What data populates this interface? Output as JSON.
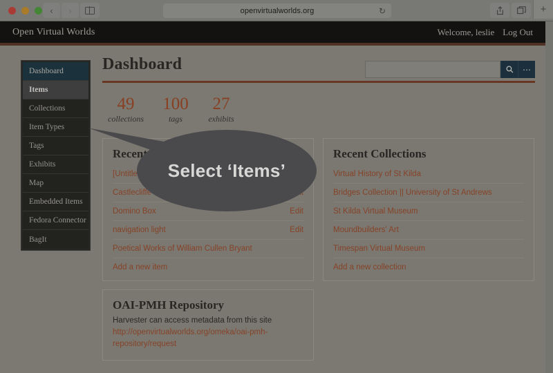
{
  "browser": {
    "url": "openvirtualworlds.org",
    "reload_icon": "reload-icon",
    "back_icon": "‹",
    "forward_icon": "›",
    "sidebar_icon": "sidebar-icon",
    "share_icon": "⇧",
    "tabs_icon": "tabs-icon",
    "newtab_icon": "+"
  },
  "site_header": {
    "title": "Open Virtual Worlds",
    "welcome": "Welcome, leslie",
    "logout": "Log Out"
  },
  "sidebar": {
    "items": [
      {
        "label": "Dashboard",
        "state": "active"
      },
      {
        "label": "Items",
        "state": "highlight"
      },
      {
        "label": "Collections",
        "state": "normal"
      },
      {
        "label": "Item Types",
        "state": "normal"
      },
      {
        "label": "Tags",
        "state": "normal"
      },
      {
        "label": "Exhibits",
        "state": "normal"
      },
      {
        "label": "Map",
        "state": "normal"
      },
      {
        "label": "Embedded Items",
        "state": "normal"
      },
      {
        "label": "Fedora Connector",
        "state": "normal"
      },
      {
        "label": "BagIt",
        "state": "normal"
      }
    ]
  },
  "main": {
    "page_title": "Dashboard",
    "search": {
      "value": "",
      "placeholder": "",
      "search_icon": "⌕",
      "options_icon": "⋯"
    },
    "stats": [
      {
        "number": "49",
        "label": "collections"
      },
      {
        "number": "100",
        "label": "tags"
      },
      {
        "number": "27",
        "label": "exhibits"
      }
    ],
    "recent_items": {
      "title": "Recent Items",
      "rows": [
        {
          "label": "[Untitled]",
          "edit": ""
        },
        {
          "label": "Castlecliffe",
          "edit": "Edit"
        },
        {
          "label": "Domino Box",
          "edit": "Edit"
        },
        {
          "label": "navigation light",
          "edit": "Edit"
        },
        {
          "label": "Poetical Works of William Cullen Bryant",
          "edit": ""
        },
        {
          "label": "Add a new item",
          "edit": ""
        }
      ]
    },
    "recent_collections": {
      "title": "Recent Collections",
      "rows": [
        {
          "label": "Virtual History of St Kilda",
          "edit": ""
        },
        {
          "label": "Bridges Collection || University of St Andrews",
          "edit": ""
        },
        {
          "label": "St Kilda Virtual Museum",
          "edit": ""
        },
        {
          "label": "Moundbuilders' Art",
          "edit": ""
        },
        {
          "label": "Timespan Virtual Museum",
          "edit": ""
        },
        {
          "label": "Add a new collection",
          "edit": ""
        }
      ]
    },
    "oai": {
      "title": "OAI-PMH Repository",
      "description": "Harvester can access metadata from this site",
      "link": "http://openvirtualworlds.org/omeka/oai-pmh-repository/request"
    }
  },
  "callout": {
    "text": "Select ‘Items’"
  },
  "colors": {
    "accent_link": "#9e4c2d",
    "stat_number": "#a14a27",
    "header_bg": "#151311",
    "header_rule": "#5c382c",
    "title_rule": "#7a3f2a",
    "nav_active": "#1e3845",
    "nav_highlight": "#48484a",
    "search_button": "#1d3746",
    "callout_bg": "#56555a"
  }
}
